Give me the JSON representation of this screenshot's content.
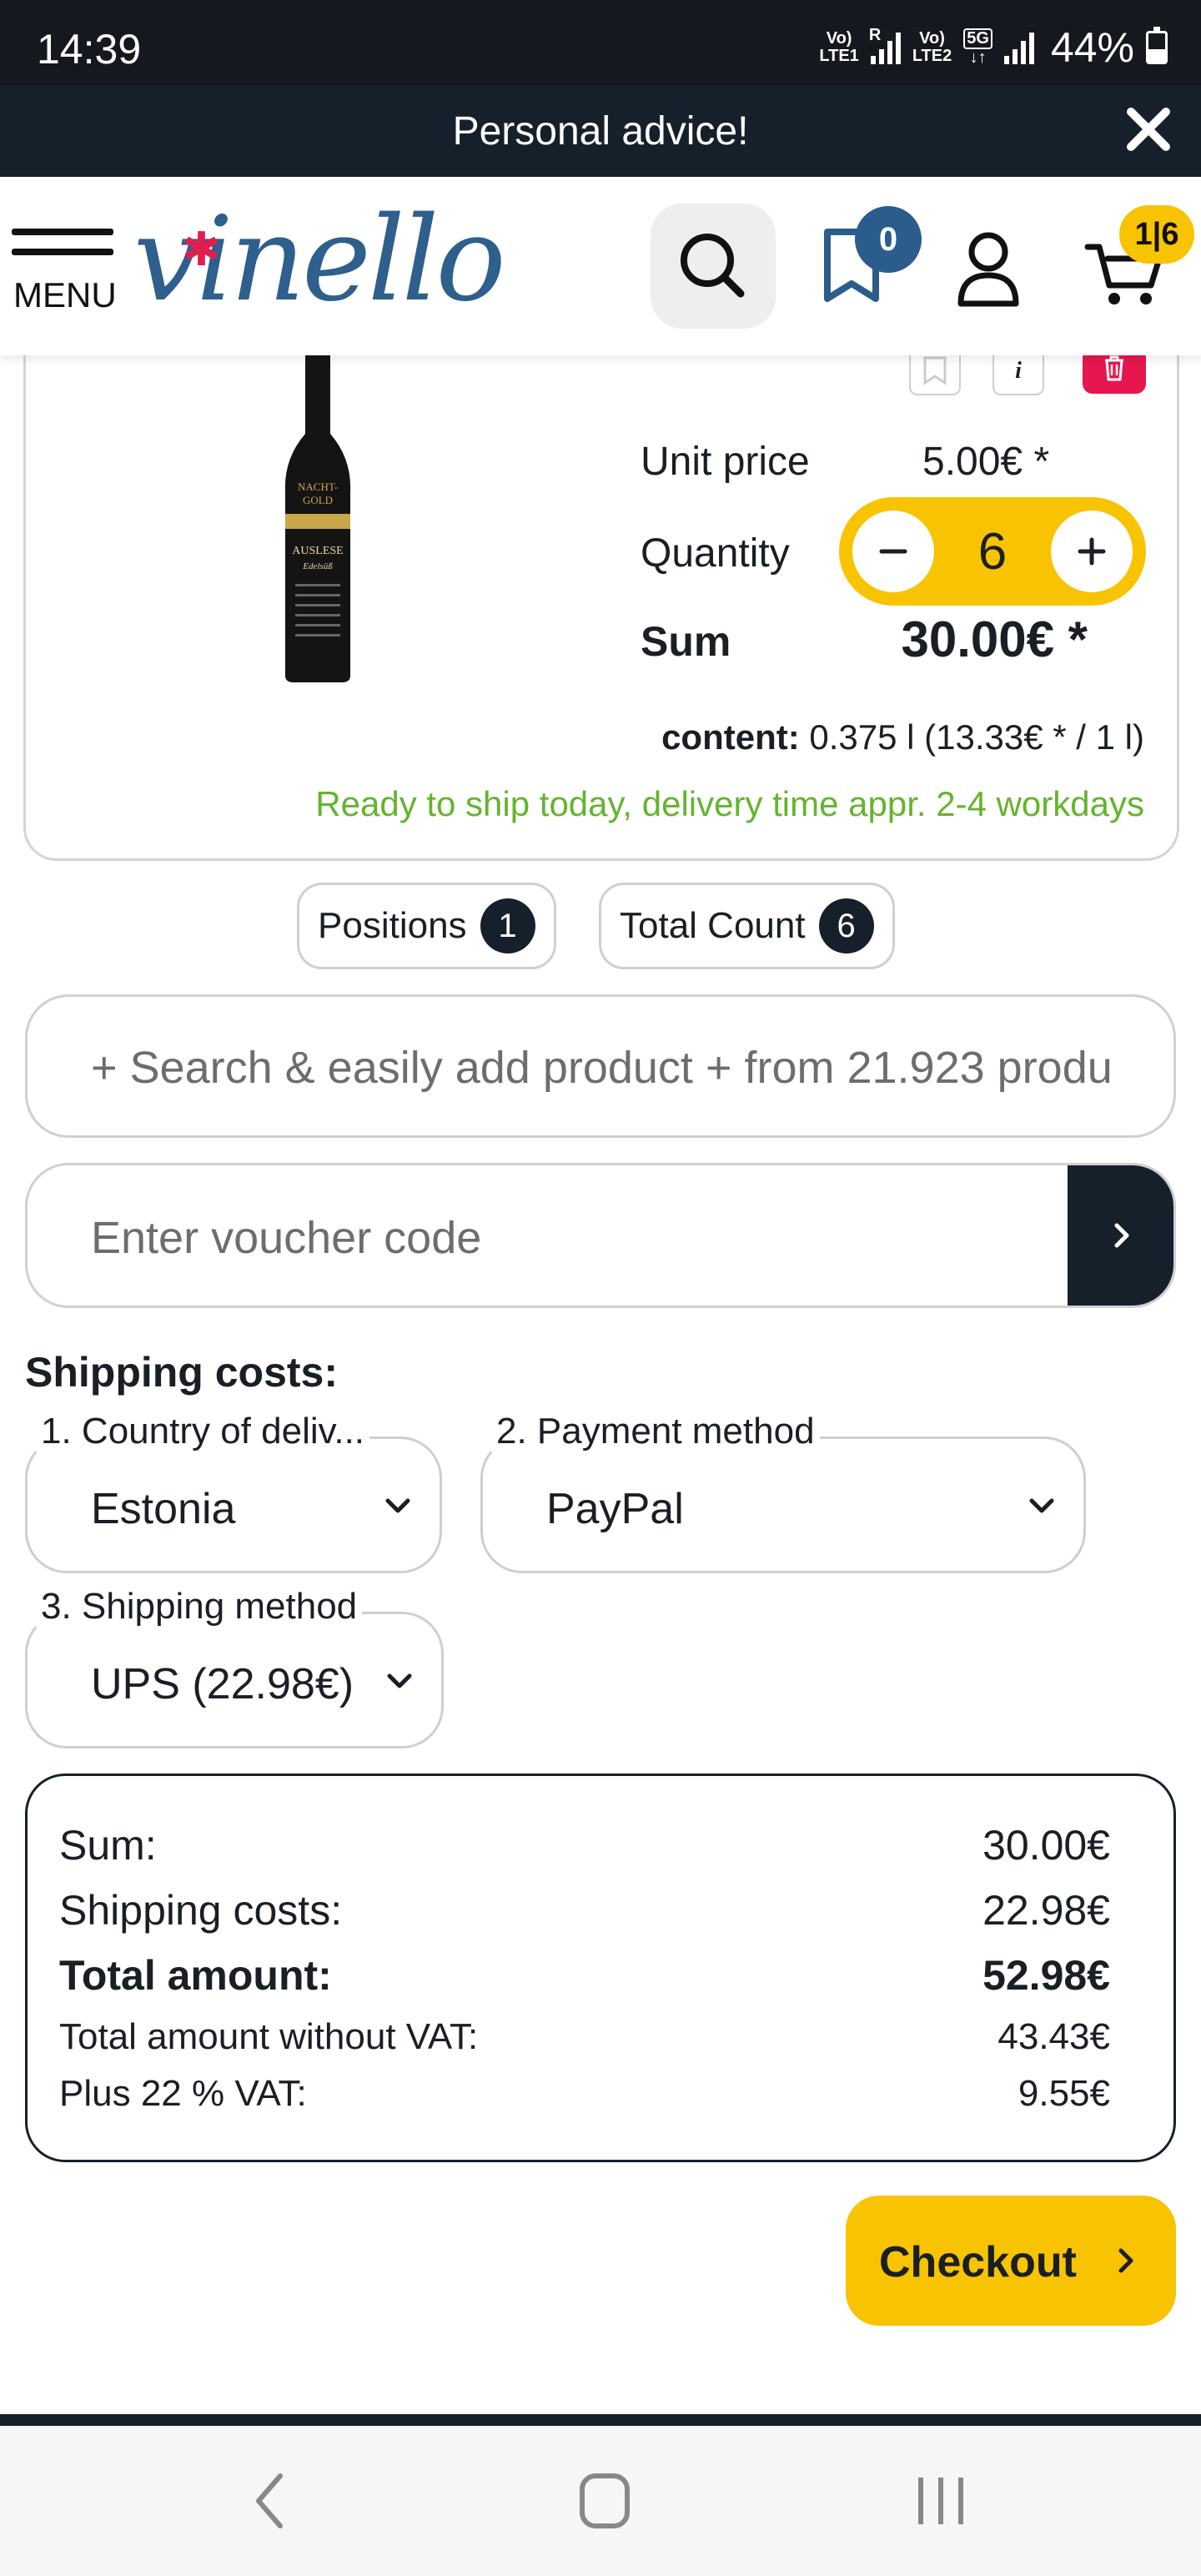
{
  "status_bar": {
    "time": "14:39",
    "net1": "Vo)",
    "net1b": "LTE1",
    "net2": "Vo)",
    "net2b": "LTE2",
    "net3": "5G",
    "roaming": "R",
    "battery": "44%",
    "battery_level": 0.44
  },
  "promo": {
    "text": "Personal advice!"
  },
  "header": {
    "menu_label": "MENU",
    "logo_text": "vinello",
    "wishlist_count": "0",
    "cart_count": "1|6"
  },
  "product": {
    "bottle_lines": [
      "NACHT-",
      "GOLD",
      "AUSLESE",
      "Edelsüß"
    ],
    "unit_price_label": "Unit price",
    "unit_price": "5.00€ *",
    "quantity_label": "Quantity",
    "quantity": "6",
    "sum_label": "Sum",
    "sum": "30.00€ *",
    "content_label": "content:",
    "content_value": "0.375 l (13.33€ * / 1 l)",
    "shipping_info": "Ready to ship today, delivery time appr. 2-4 workdays"
  },
  "counts": {
    "positions_label": "Positions",
    "positions": "1",
    "total_label": "Total Count",
    "total": "6"
  },
  "search_add": {
    "text": "+ Search & easily add product + from 21.923 produ"
  },
  "voucher": {
    "placeholder": "Enter voucher code"
  },
  "shipping": {
    "title": "Shipping costs:",
    "country_label": "1. Country of deliv...",
    "country_value": "Estonia",
    "payment_label": "2. Payment method",
    "payment_value": "PayPal",
    "method_label": "3. Shipping method",
    "method_value": "UPS (22.98€)"
  },
  "totals": {
    "sum_label": "Sum:",
    "sum": "30.00€",
    "shipping_label": "Shipping costs:",
    "shipping": "22.98€",
    "total_label": "Total amount:",
    "total": "52.98€",
    "net_label": "Total amount without VAT:",
    "net": "43.43€",
    "vat_label": "Plus 22 % VAT:",
    "vat": "9.55€"
  },
  "checkout": {
    "label": "Checkout"
  },
  "colors": {
    "accent_yellow": "#f8c300",
    "navy": "#15202b",
    "brand_blue": "#2a5d8b",
    "delete_red": "#e6174f",
    "ship_green": "#64b42d"
  },
  "icons": [
    "close-icon",
    "search-icon",
    "bookmark-icon",
    "user-icon",
    "cart-icon",
    "bookmark-outline-icon",
    "info-icon",
    "trash-icon",
    "minus-icon",
    "plus-icon",
    "chevron-right-icon",
    "chevron-down-icon",
    "back-icon",
    "home-icon",
    "recents-icon"
  ]
}
